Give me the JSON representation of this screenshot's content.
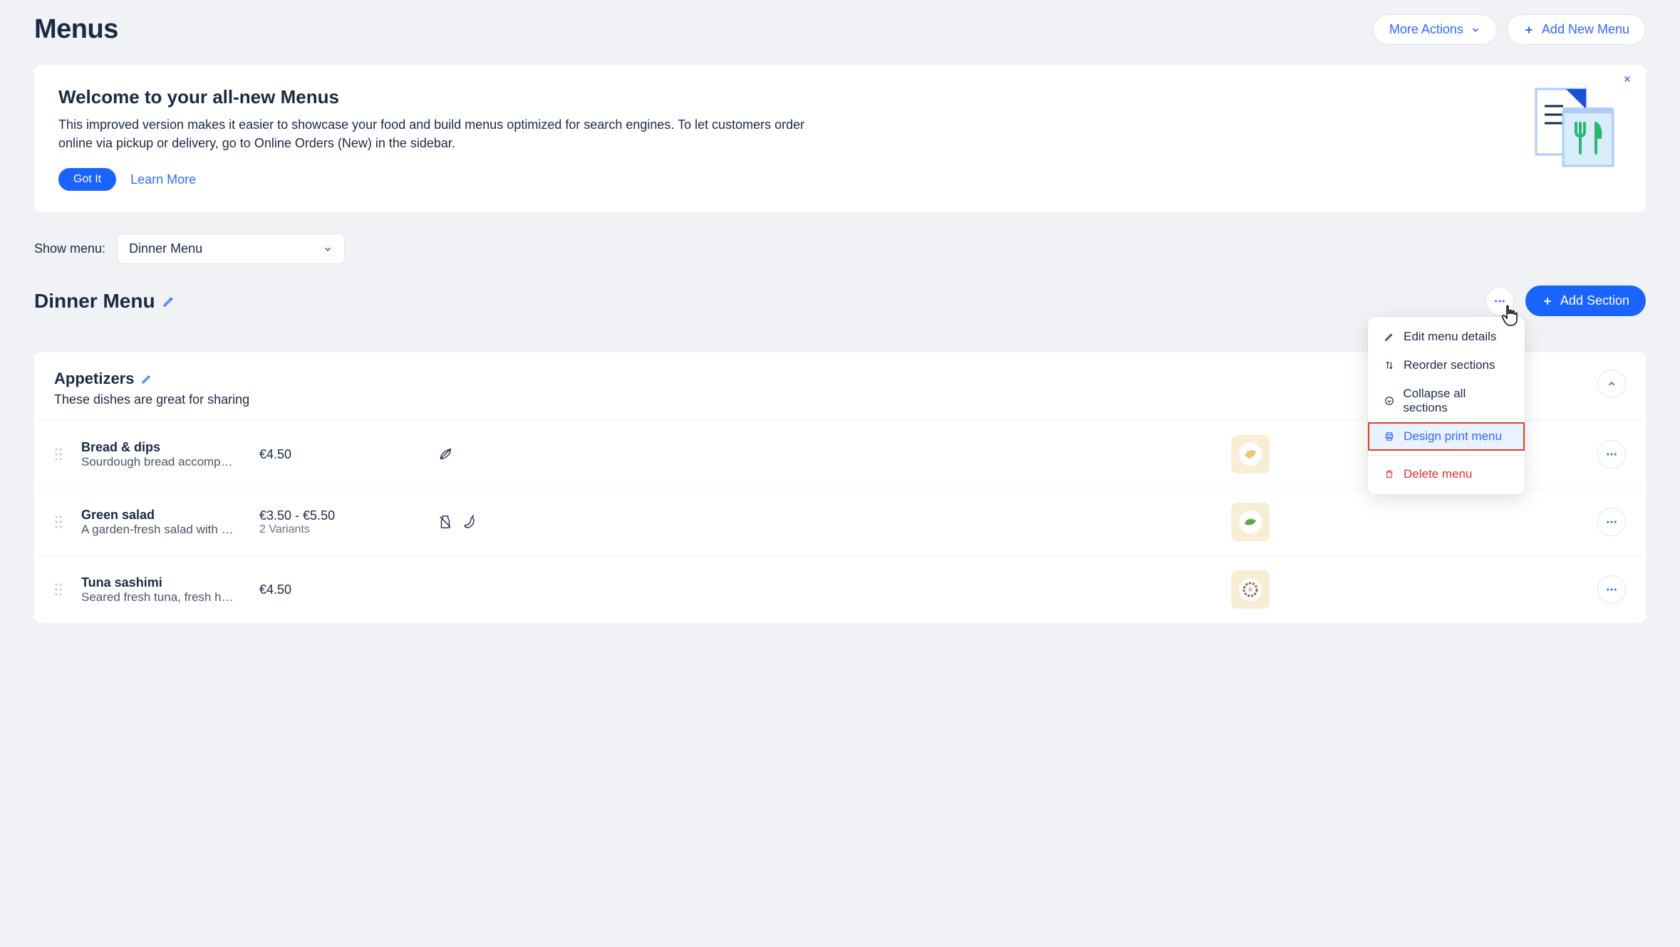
{
  "header": {
    "title": "Menus",
    "more_actions": "More Actions",
    "add_menu": "Add New Menu"
  },
  "banner": {
    "title": "Welcome to your all-new Menus",
    "body": "This improved version makes it easier to showcase your food and build menus optimized for search engines.  To let customers order online via pickup or delivery, go to Online Orders (New) in the sidebar.",
    "got_it": "Got It",
    "learn_more": "Learn More"
  },
  "filter": {
    "label": "Show menu:",
    "value": "Dinner Menu"
  },
  "menu": {
    "title": "Dinner Menu",
    "add_section": "Add Section"
  },
  "dropdown": {
    "edit": "Edit menu details",
    "reorder": "Reorder sections",
    "collapse": "Collapse all sections",
    "print": "Design print menu",
    "delete": "Delete menu"
  },
  "section": {
    "title": "Appetizers",
    "desc": "These dishes are great for sharing"
  },
  "items": [
    {
      "name": "Bread & dips",
      "desc": "Sourdough bread accompa…",
      "price": "€4.50",
      "variants": "",
      "icons": [
        "leaf"
      ]
    },
    {
      "name": "Green salad",
      "desc": "A garden-fresh salad with se…",
      "price": "€3.50 - €5.50",
      "variants": "2 Variants",
      "icons": [
        "dairy-free",
        "chili"
      ]
    },
    {
      "name": "Tuna sashimi",
      "desc": "Seared fresh tuna, fresh her…",
      "price": "€4.50",
      "variants": "",
      "icons": []
    }
  ]
}
